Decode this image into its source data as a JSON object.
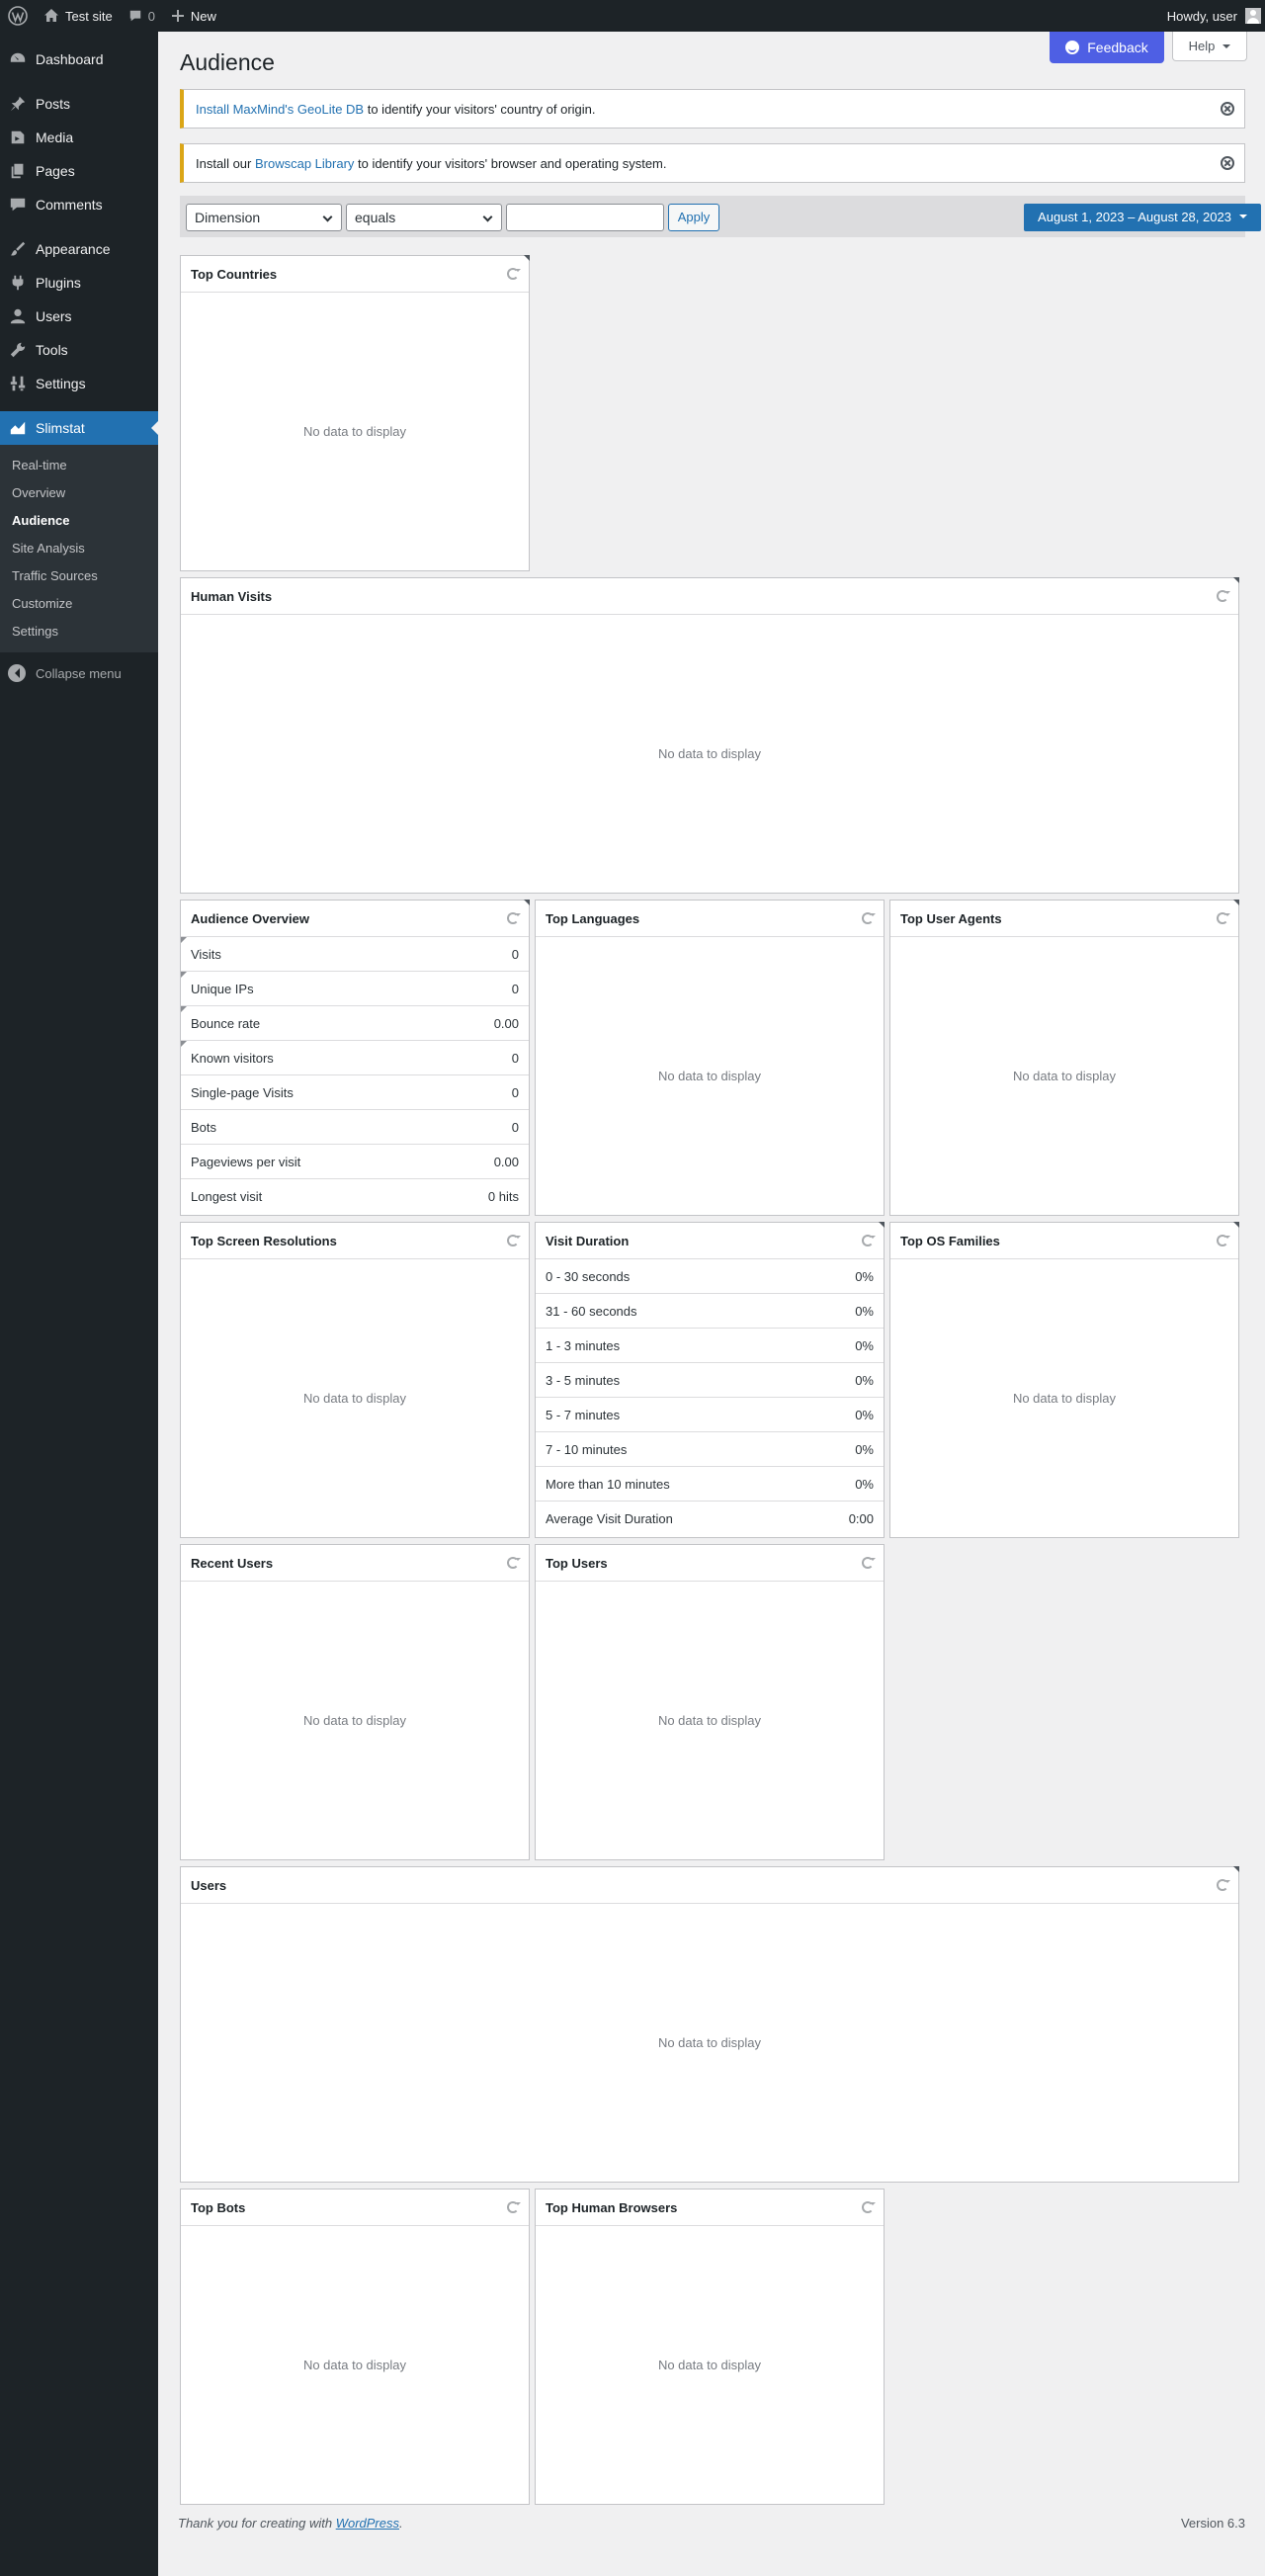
{
  "adminbar": {
    "site_name": "Test site",
    "comments_count": "0",
    "new_label": "New",
    "howdy": "Howdy, user"
  },
  "sidebar": {
    "items": [
      {
        "label": "Dashboard",
        "icon": "dashboard-icon"
      },
      {
        "label": "Posts",
        "icon": "pin-icon"
      },
      {
        "label": "Media",
        "icon": "media-icon"
      },
      {
        "label": "Pages",
        "icon": "pages-icon"
      },
      {
        "label": "Comments",
        "icon": "comment-icon"
      },
      {
        "label": "Appearance",
        "icon": "brush-icon"
      },
      {
        "label": "Plugins",
        "icon": "plug-icon"
      },
      {
        "label": "Users",
        "icon": "user-icon"
      },
      {
        "label": "Tools",
        "icon": "wrench-icon"
      },
      {
        "label": "Settings",
        "icon": "settings-icon"
      },
      {
        "label": "Slimstat",
        "icon": "chart-icon"
      }
    ],
    "submenu": [
      "Real-time",
      "Overview",
      "Audience",
      "Site Analysis",
      "Traffic Sources",
      "Customize",
      "Settings"
    ],
    "collapse_label": "Collapse menu"
  },
  "header": {
    "title": "Audience",
    "feedback_label": "Feedback",
    "help_label": "Help"
  },
  "notices": {
    "geolite_link": "Install MaxMind's GeoLite DB",
    "geolite_rest": " to identify your visitors' country of origin.",
    "browscap_pre": "Install our ",
    "browscap_link": "Browscap Library",
    "browscap_rest": " to identify your visitors' browser and operating system."
  },
  "filters": {
    "dimension": "Dimension",
    "operator": "equals",
    "value": "",
    "apply_label": "Apply",
    "date_range": "August 1, 2023 – August 28, 2023"
  },
  "no_data": "No data to display",
  "boxes": {
    "top_countries": "Top Countries",
    "human_visits": "Human Visits",
    "audience_overview": "Audience Overview",
    "top_languages": "Top Languages",
    "top_user_agents": "Top User Agents",
    "top_screen_resolutions": "Top Screen Resolutions",
    "visit_duration": "Visit Duration",
    "top_os_families": "Top OS Families",
    "recent_users": "Recent Users",
    "top_users": "Top Users",
    "users": "Users",
    "top_bots": "Top Bots",
    "top_human_browsers": "Top Human Browsers"
  },
  "audience_overview_rows": [
    {
      "label": "Visits",
      "value": "0"
    },
    {
      "label": "Unique IPs",
      "value": "0"
    },
    {
      "label": "Bounce rate",
      "value": "0.00"
    },
    {
      "label": "Known visitors",
      "value": "0"
    },
    {
      "label": "Single-page Visits",
      "value": "0"
    },
    {
      "label": "Bots",
      "value": "0"
    },
    {
      "label": "Pageviews per visit",
      "value": "0.00"
    },
    {
      "label": "Longest visit",
      "value": "0 hits"
    }
  ],
  "visit_duration_rows": [
    {
      "label": "0 - 30 seconds",
      "value": "0%"
    },
    {
      "label": "31 - 60 seconds",
      "value": "0%"
    },
    {
      "label": "1 - 3 minutes",
      "value": "0%"
    },
    {
      "label": "3 - 5 minutes",
      "value": "0%"
    },
    {
      "label": "5 - 7 minutes",
      "value": "0%"
    },
    {
      "label": "7 - 10 minutes",
      "value": "0%"
    },
    {
      "label": "More than 10 minutes",
      "value": "0%"
    },
    {
      "label": "Average Visit Duration",
      "value": "0:00"
    }
  ],
  "footer": {
    "thanks": "Thank you for creating with ",
    "wp_link": "WordPress",
    "period": ".",
    "version": "Version 6.3"
  }
}
